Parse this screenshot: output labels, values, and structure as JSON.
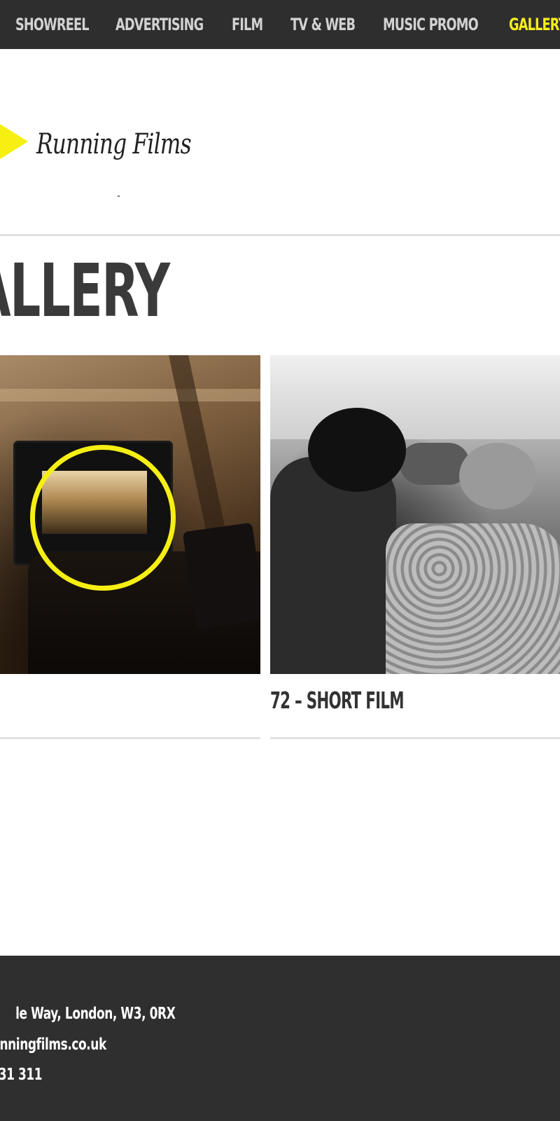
{
  "nav": {
    "items": [
      {
        "label": "SHOWREEL"
      },
      {
        "label": "ADVERTISING"
      },
      {
        "label": "FILM"
      },
      {
        "label": "TV & WEB"
      },
      {
        "label": "MUSIC PROMO"
      },
      {
        "label": "GALLERY"
      }
    ],
    "active_color": "#f5ee1c",
    "background": "#2e2e2e"
  },
  "logo": {
    "text": "Running Films",
    "accent_color": "#f6ef10"
  },
  "page": {
    "title": "ALLERY"
  },
  "gallery": {
    "tiles": [
      {
        "caption": ""
      },
      {
        "caption": "72 – SHORT FILM"
      }
    ]
  },
  "footer": {
    "address": "le Way, London, W3, 0RX",
    "email": "nningfilms.co.uk",
    "phone": "31 311"
  }
}
